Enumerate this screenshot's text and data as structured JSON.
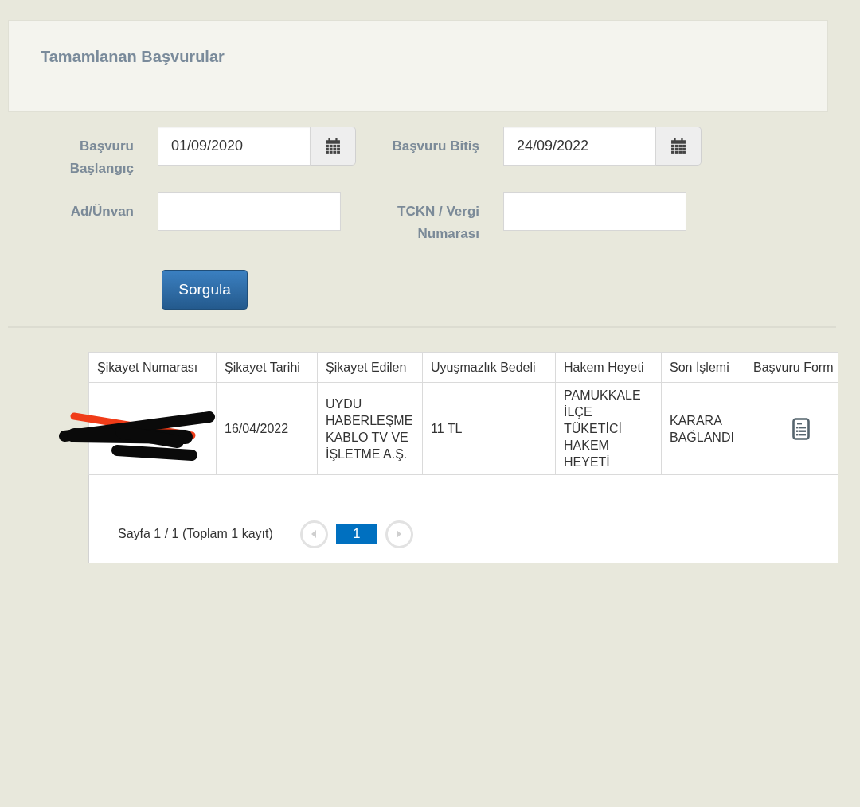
{
  "page": {
    "title": "Tamamlanan Başvurular"
  },
  "filters": [
    {
      "kind": "date",
      "label": "Başvuru Başlangıç",
      "value": "01/09/2020"
    },
    {
      "kind": "date",
      "label": "Başvuru Bitiş",
      "value": "24/09/2022"
    },
    {
      "kind": "text",
      "label": "Ad/Ünvan"
    },
    {
      "kind": "text",
      "label": "TCKN / Vergi Numarası"
    }
  ],
  "query_button": {
    "label": "Sorgula"
  },
  "table": {
    "columns": [
      "Şikayet Numarası",
      "Şikayet Tarihi",
      "Şikayet Edilen",
      "Uyuşmazlık Bedeli",
      "Hakem Heyeti",
      "Son İşlemi",
      "Başvuru Form"
    ],
    "rows": [
      {
        "cells": [
          {
            "kind": "redacted"
          },
          {
            "kind": "text",
            "text": "16/04/2022"
          },
          {
            "kind": "text",
            "text": "UYDU HABERLEŞME KABLO TV VE İŞLETME A.Ş."
          },
          {
            "kind": "text",
            "text": "11 TL"
          },
          {
            "kind": "text",
            "text": "PAMUKKALE İLÇE TÜKETİCİ HAKEM HEYETİ"
          },
          {
            "kind": "text",
            "text": "KARARA BAĞLANDI"
          },
          {
            "kind": "document_link"
          }
        ]
      }
    ]
  },
  "pagination": {
    "summary": "Sayfa 1 / 1 (Toplam 1 kayıt)",
    "previous": {
      "disabled": true
    },
    "pages": [
      {
        "label": "1",
        "selected": true
      }
    ],
    "next": {
      "disabled": true
    }
  }
}
